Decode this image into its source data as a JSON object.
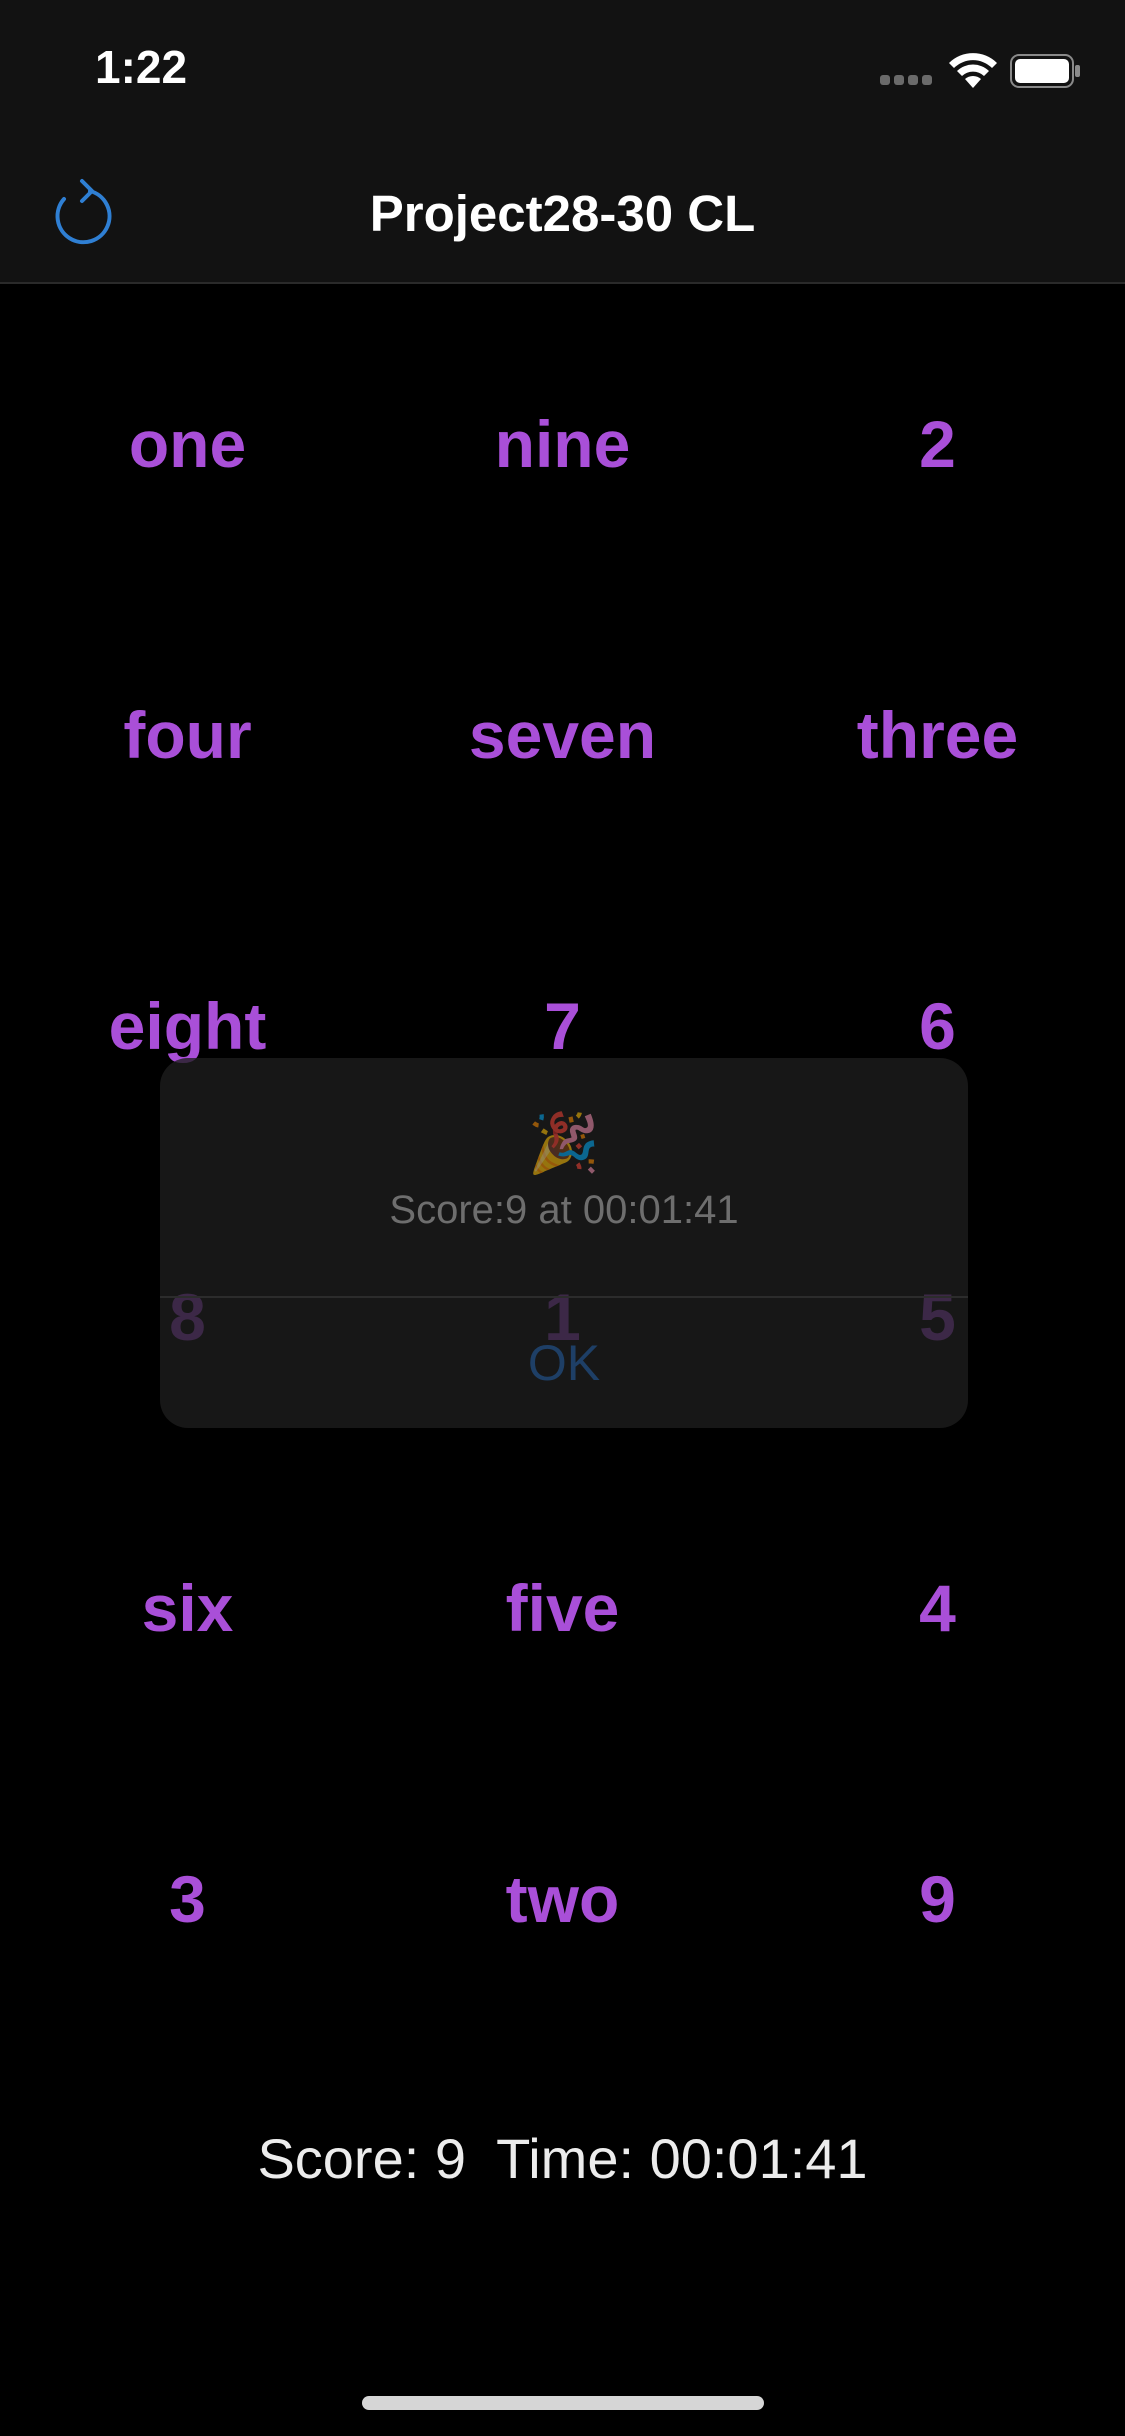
{
  "status_bar": {
    "time": "1:22"
  },
  "nav": {
    "title": "Project28-30 CL",
    "refresh_icon": "refresh-icon",
    "accent_color": "#2f7fd3"
  },
  "grid": {
    "text_color": "#a94fd8",
    "cards": [
      [
        "one",
        "nine",
        "2"
      ],
      [
        "four",
        "seven",
        "three"
      ],
      [
        "eight",
        "7",
        "6"
      ],
      [
        "8",
        "1",
        "5"
      ],
      [
        "six",
        "five",
        "4"
      ],
      [
        "3",
        "two",
        "9"
      ]
    ]
  },
  "alert": {
    "emoji": "🎉",
    "message": "Score:9 at 00:01:41",
    "ok_label": "OK"
  },
  "footer": {
    "score_text": "Score: 9  Time: 00:01:41"
  }
}
